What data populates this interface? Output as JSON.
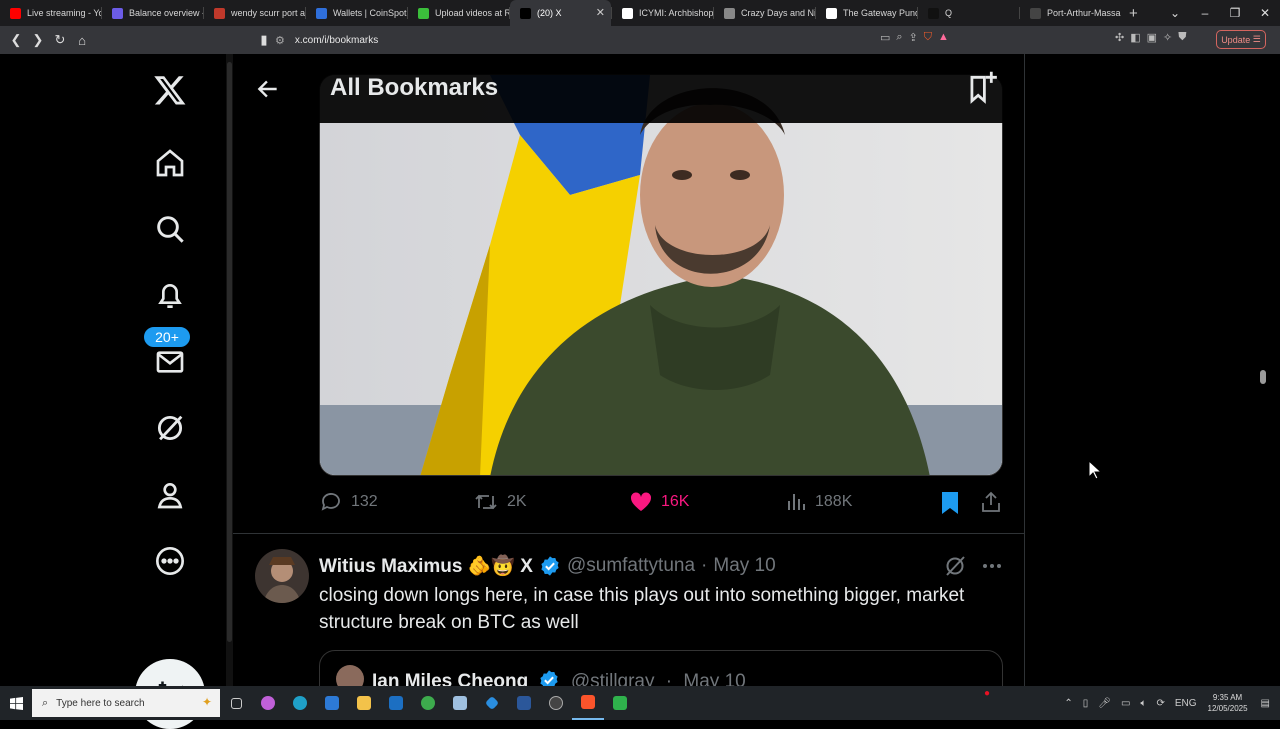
{
  "browser": {
    "tabs": [
      {
        "title": "Live streaming - Yo",
        "color": "#ff0000"
      },
      {
        "title": "Balance overview -",
        "color": "#6c5ce7"
      },
      {
        "title": "wendy scurr port ar",
        "color": "#c0392b"
      },
      {
        "title": "Wallets | CoinSpot",
        "color": "#2f6fdb"
      },
      {
        "title": "Upload videos at R",
        "color": "#3bbf3b"
      },
      {
        "title": "(20) X",
        "color": "#000000",
        "active": true
      },
      {
        "title": "ICYMI: Archbishop",
        "color": "#ffffff"
      },
      {
        "title": "Crazy Days and Nig",
        "color": "#888888"
      },
      {
        "title": "The Gateway Pundi",
        "color": "#ffffff"
      },
      {
        "title": "Q",
        "color": "#111111"
      },
      {
        "title": "Port-Arthur-Massa",
        "color": "#444444"
      }
    ],
    "new_tab": "+",
    "url": "x.com/i/bookmarks",
    "update_label": "Update"
  },
  "sidebar": {
    "notification_count": "20+"
  },
  "header": {
    "title": "All Bookmarks"
  },
  "post1": {
    "replies": "132",
    "reposts": "2K",
    "likes": "16K",
    "views": "188K",
    "like_color": "#f91880",
    "bookmark_color": "#1d9bf0"
  },
  "post2": {
    "author_name": "Witius Maximus 🫵🤠 X",
    "handle": "@sumfattytuna",
    "separator": "·",
    "date": "May 10",
    "text": "closing down longs here, in case this plays out into something bigger, market structure break on BTC as well",
    "quote": {
      "author_name": "Ian Miles Cheong",
      "handle": "@stillgray",
      "separator": "·",
      "date": "May 10"
    }
  },
  "taskbar": {
    "search_placeholder": "Type here to search",
    "language": "ENG",
    "time": "9:35 AM",
    "date": "12/05/2025"
  }
}
